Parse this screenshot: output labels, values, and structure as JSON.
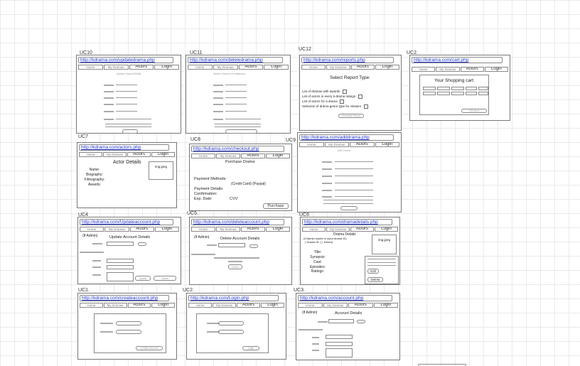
{
  "nav": {
    "home": "Home",
    "dramas": "My Dramas",
    "actors": "Actors",
    "login": "Login"
  },
  "uc": {
    "uc10": {
      "label": "UC10",
      "url": "http://kdrama.com/updatedrama.php",
      "heading": "Update Drama Details"
    },
    "uc11": {
      "label": "UC11",
      "url": "http://kdrama.com/deletedrama.php",
      "heading": "Delete Drama from database"
    },
    "uc12": {
      "label": "UC12",
      "url": "http://kdrama.com/reports.php",
      "title": "Select Report Type:",
      "items": [
        "List of dramas with awards :",
        "List of actors in every k-drama ratings :",
        "List of actors for a drama :",
        "Selection of drama genre type for viewers :"
      ],
      "button": "Generate Report"
    },
    "uc2b": {
      "label": "UC2.",
      "url": "http://kdrama.com/cart.php",
      "title": "Your Shopping cart",
      "button": "Checkout"
    },
    "uc7": {
      "label": "UC7",
      "url": "http://kdrama.com/actors.php",
      "title": "Actor Details",
      "image": "img.jpeg",
      "fields": [
        "Name:",
        "Biography:",
        "Filmography:",
        "Awards:"
      ]
    },
    "uc8": {
      "label": "UC8",
      "url": "http://kdrama.com/checkout.php",
      "title": "Purchase Drama",
      "payment": "Payment Methods:",
      "methods": "(Credit Card) (Paypal)",
      "details": "Payment Details:",
      "confirm": "Confirmation:",
      "exp": "Exp. Date:",
      "cvv": "CVV:",
      "button": "Purchase"
    },
    "uc9": {
      "label": "UC9",
      "url": "http://kdrama.com/adddrama.php",
      "heading": "Add Drama"
    },
    "uc4": {
      "label": "UC4",
      "url": "http://kdrama.com/Updateaccount.php",
      "title": "Update Account Details",
      "admin": "(If Admin)",
      "button1": "Update",
      "button2": "Delete"
    },
    "uc5": {
      "label": "UC5.",
      "url": "http://kdrama.com/deleteaccount.php",
      "title": "Delete Account Details",
      "admin": "(If Admin)",
      "button": "Delete"
    },
    "uc6": {
      "label": "UC6",
      "url": "http://kdrama.com/dramadetails.php",
      "title": "Drama Details",
      "line1": "(If Admin wants to Input drama ID)",
      "line2": "( Drama ID: ) ( Select)",
      "image": "img.jpeg",
      "fields": [
        "Title:",
        "Synopsis:",
        "Cast:",
        "Episodes:",
        "Ratings:"
      ],
      "edit": "Edit",
      "delete": "Delete"
    },
    "uc1": {
      "label": "UC1.",
      "url": "http://kdrama.com/createaccount.php",
      "button": "Create Account"
    },
    "uc2": {
      "label": "UC2.",
      "url": "http://kdrama.com/Login.php",
      "button": "Login"
    },
    "uc3": {
      "label": "UC3.",
      "url": "http://kdrama.com/account.php",
      "title": "Account Details",
      "admin": "(If Admin)"
    }
  }
}
